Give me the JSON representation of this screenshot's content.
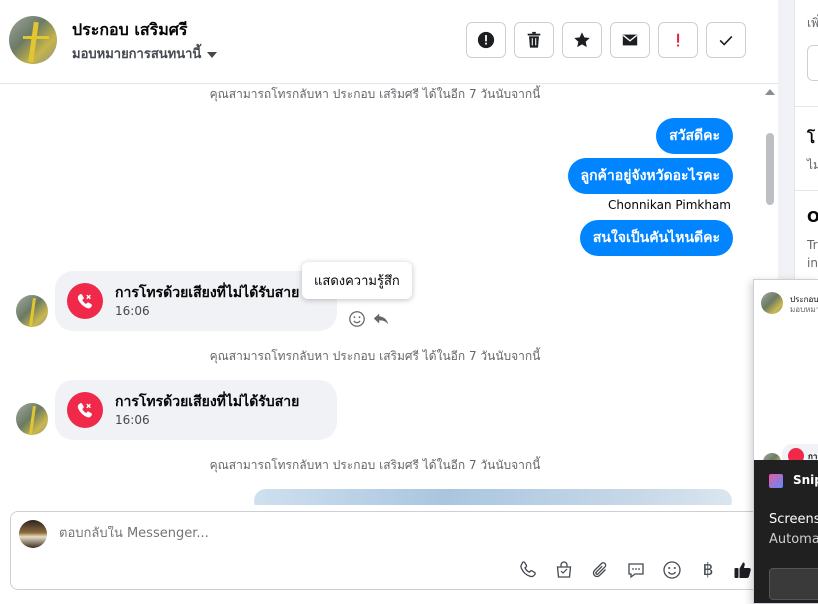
{
  "header": {
    "contact_name": "ประกอบ เสริมศรี",
    "assign_label": "มอบหมายการสนทนานี้",
    "actions": [
      {
        "name": "spam-button",
        "icon": "alert-circle-icon"
      },
      {
        "name": "delete-button",
        "icon": "trash-icon"
      },
      {
        "name": "star-button",
        "icon": "star-icon"
      },
      {
        "name": "mark-unread-button",
        "icon": "envelope-icon"
      },
      {
        "name": "follow-up-button",
        "icon": "exclamation-icon"
      },
      {
        "name": "mark-done-button",
        "icon": "check-icon"
      }
    ]
  },
  "chat": {
    "call_back_note": "คุณสามารถโทรกลับหา ประกอบ เสริมศรี ได้ในอีก 7 วันนับจากนี้",
    "outgoing": [
      "สวัสดีคะ",
      "ลูกค้าอยู่จังหวัดอะไรคะ",
      "สนใจเป็นคันไหนดีคะ"
    ],
    "sender_label": "Chonnikan Pimkham",
    "missed_call_title": "การโทรด้วยเสียงที่ไม่ได้รับสาย",
    "missed_call_time": "16:06",
    "react_tooltip": "แสดงความรู้สึก"
  },
  "composer": {
    "placeholder": "ตอบกลับใน Messenger...",
    "currency_symbol": "฿"
  },
  "right_panel": {
    "text_top": "เพิ่",
    "heading_1": "โ",
    "sub_1": "ไม",
    "heading_2": "O",
    "sub_2a": "Tr",
    "sub_2b": "in"
  },
  "overlay": {
    "preview_name": "ประกอบ เสริมศรี",
    "preview_sub": "มอบหมายการสนทนานี้",
    "call_peek": "กา",
    "snip_app": "Snip",
    "snip_title": "Screensh",
    "snip_sub": "Automa"
  },
  "colors": {
    "brand_blue": "#0084ff",
    "missed_call_red": "#f02849",
    "bubble_gray": "#f0f2f5"
  }
}
